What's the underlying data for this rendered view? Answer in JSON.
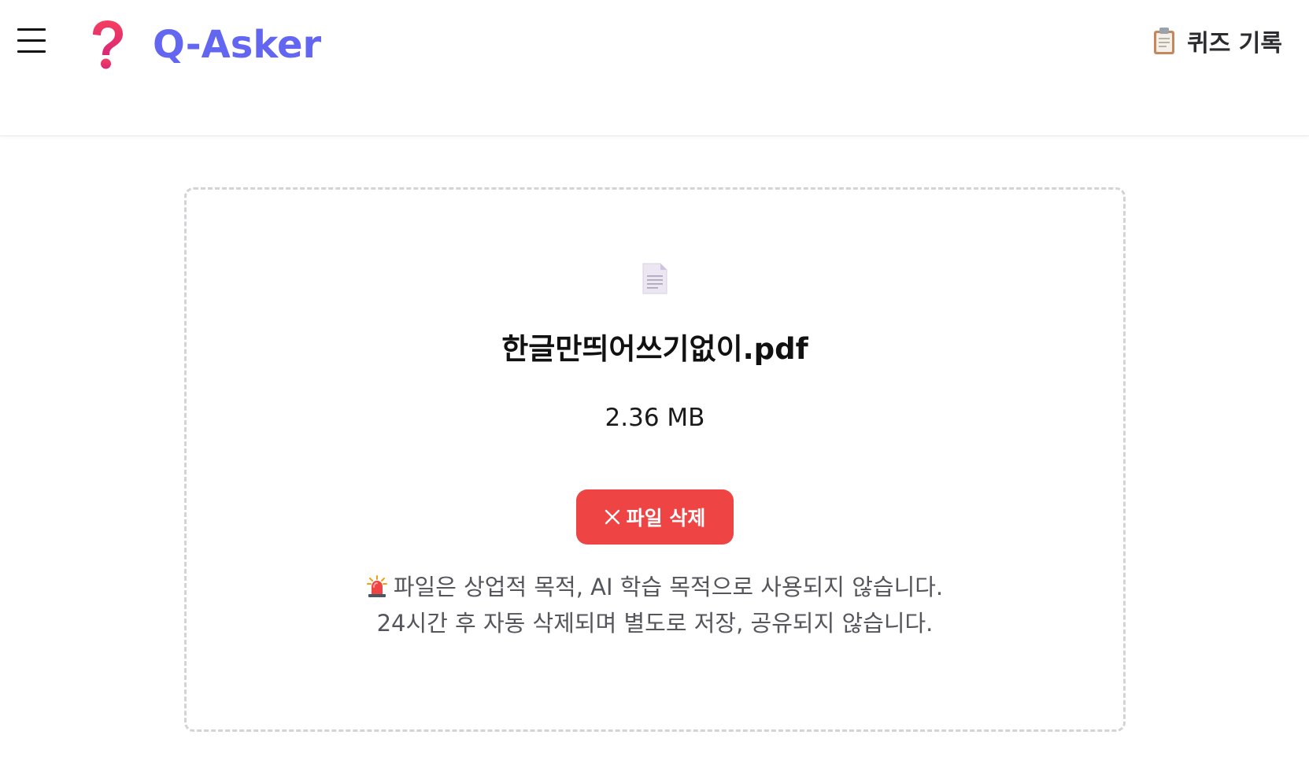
{
  "header": {
    "app_name": "Q-Asker",
    "logo_icon": "question-mark-icon",
    "menu_icon": "hamburger-menu-icon",
    "history_icon": "clipboard-icon",
    "history_label": "퀴즈 기록"
  },
  "upload": {
    "file_icon": "document-icon",
    "file_name": "한글만띄어쓰기없이.pdf",
    "file_size": "2.36 MB",
    "delete_label": "파일 삭제",
    "delete_icon": "close-icon",
    "notice_icon": "siren-icon",
    "notice_line1": "파일은 상업적 목적, AI 학습 목적으로 사용되지 않습니다.",
    "notice_line2": "24시간 후 자동 삭제되며 별도로 저장, 공유되지 않습니다."
  },
  "colors": {
    "brand": "#6366f1",
    "danger": "#ef4444",
    "logo_red": "#e11d48",
    "border": "#d3d3d8",
    "notice_text": "#55555c"
  }
}
